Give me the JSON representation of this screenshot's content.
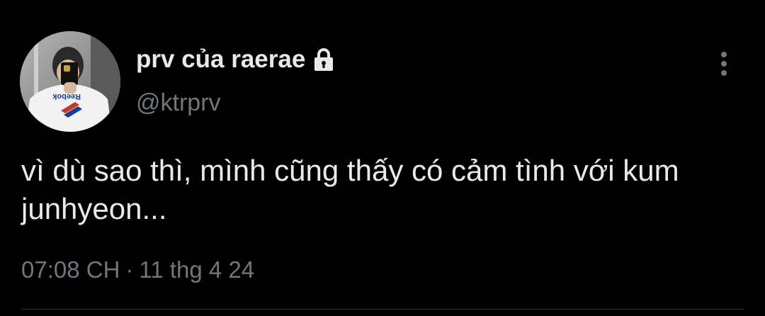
{
  "tweet": {
    "display_name": "prv của raerae",
    "handle": "@ktrprv",
    "text": "vì dù sao thì, mình cũng thấy có cảm tình với kum junhyeon...",
    "time": "07:08 CH",
    "separator": "·",
    "date": "11 thg 4 24",
    "protected_icon": "lock-icon",
    "more_icon": "more-vertical-icon",
    "avatar_shirt_text": "Reebok"
  },
  "colors": {
    "background": "#000000",
    "primary_text": "#e7e9ea",
    "secondary_text": "#71767b"
  }
}
